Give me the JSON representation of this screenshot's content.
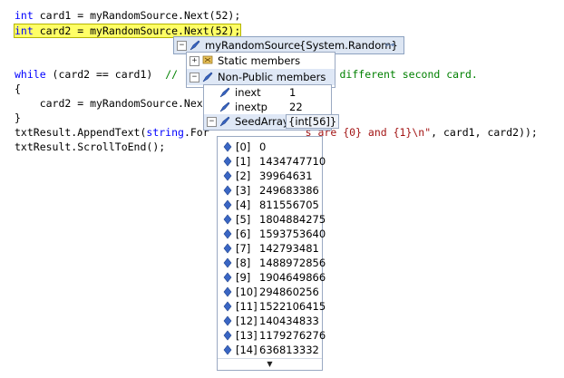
{
  "code": {
    "line1": {
      "kw": "int",
      "rest": " card1 = myRandomSource.Next(52);"
    },
    "line2": {
      "kw": "int",
      "rest": " card2 = myRandomSource.Next(52);"
    },
    "line3": {
      "kw": "while",
      "rest": " (card2 == card1)  ",
      "comment": "// ",
      "comment_tail": "get a different second card."
    },
    "line4": "{",
    "line5": {
      "rest": "    card2 = myRandomSource.Nex"
    },
    "line6": "}",
    "line7": {
      "pre": "txtResult.AppendText(",
      "kw": "string",
      "mid": ".For",
      "str_tail": "s are {0} and {1}\\n\"",
      "post": ", card1, card2));"
    },
    "line8": "txtResult.ScrollToEnd();"
  },
  "datatip": {
    "root": {
      "name": "myRandomSource",
      "value": "{System.Random}"
    },
    "groups": [
      {
        "label": "Static members",
        "expander": "+"
      },
      {
        "label": "Non-Public members",
        "expander": "-"
      }
    ],
    "fields": [
      {
        "name": "inext",
        "value": "1"
      },
      {
        "name": "inextp",
        "value": "22"
      },
      {
        "name": "SeedArray",
        "value": "{int[56]}",
        "expander": "-"
      }
    ],
    "seed_items": [
      {
        "index": "[0]",
        "value": "0"
      },
      {
        "index": "[1]",
        "value": "1434747710"
      },
      {
        "index": "[2]",
        "value": "39964631"
      },
      {
        "index": "[3]",
        "value": "249683386"
      },
      {
        "index": "[4]",
        "value": "811556705"
      },
      {
        "index": "[5]",
        "value": "1804884275"
      },
      {
        "index": "[6]",
        "value": "1593753640"
      },
      {
        "index": "[7]",
        "value": "142793481"
      },
      {
        "index": "[8]",
        "value": "1488972856"
      },
      {
        "index": "[9]",
        "value": "1904649866"
      },
      {
        "index": "[10]",
        "value": "294860256"
      },
      {
        "index": "[11]",
        "value": "1522106415"
      },
      {
        "index": "[12]",
        "value": "140434833"
      },
      {
        "index": "[13]",
        "value": "1179276276"
      },
      {
        "index": "[14]",
        "value": "636813332"
      }
    ],
    "scroll_down_glyph": "▼",
    "pin_glyph": "⊶"
  }
}
